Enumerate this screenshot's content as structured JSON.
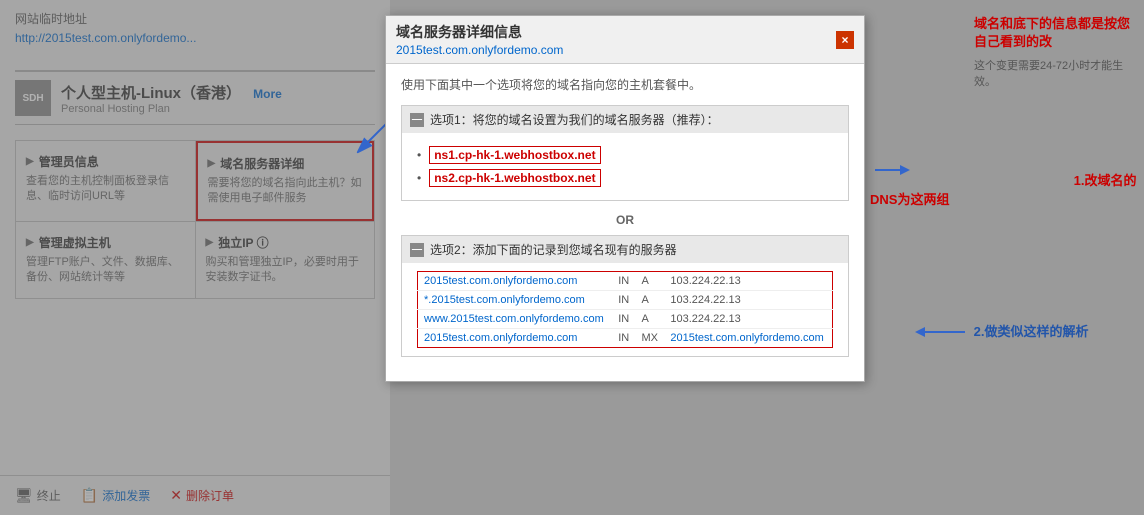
{
  "page": {
    "title": "网站临时地址",
    "site_url": "http://2015test.com.onlyfordemo...",
    "hosting_plan": {
      "logo": "SDH",
      "name": "个人型主机-Linux（香港）",
      "subtitle": "Personal Hosting Plan",
      "more_label": "More"
    },
    "menu_items": [
      {
        "title": "管理员信息",
        "desc": "查看您的主机控制面板登录信息、临时访问URL等",
        "highlighted": false
      },
      {
        "title": "域名服务器详细",
        "desc": "需要将您的域名指向此主机？如需使用电子邮件服务",
        "highlighted": true
      },
      {
        "title": "管理虚拟主机",
        "desc": "管理FTP账户、文件、数据库、备份、网站统计等等",
        "highlighted": false
      },
      {
        "title": "独立IP ⓘ",
        "desc": "购买和管理独立IP，必要时用于安装数字证书。",
        "highlighted": false
      }
    ],
    "bottom_actions": [
      {
        "icon": "🖥",
        "label": "终止",
        "type": "normal"
      },
      {
        "icon": "📋",
        "label": "添加发票",
        "type": "add"
      },
      {
        "icon": "✕",
        "label": "删除订单",
        "type": "delete"
      }
    ]
  },
  "modal": {
    "title": "域名服务器详细信息",
    "domain": "2015test.com.onlyfordemo.com",
    "intro": "使用下面其中一个选项将您的域名指向您的主机套餐中。",
    "option1": {
      "label": "选项1：将您的域名设置为我们的域名服务器（推荐）：",
      "ns1": "ns1.cp-hk-1.webhostbox.net",
      "ns2": "ns2.cp-hk-1.webhostbox.net"
    },
    "or_text": "OR",
    "option2": {
      "label": "选项2：添加下面的记录到您域名现有的服务器",
      "records": [
        {
          "domain": "2015test.com.onlyfordemo.com",
          "class": "IN",
          "type": "A",
          "value": "103.224.22.13"
        },
        {
          "domain": "*.2015test.com.onlyfordemo.com",
          "class": "IN",
          "type": "A",
          "value": "103.224.22.13"
        },
        {
          "domain": "www.2015test.com.onlyfordemo.com",
          "class": "IN",
          "type": "A",
          "value": "103.224.22.13"
        },
        {
          "domain": "2015test.com.onlyfordemo.com",
          "class": "IN",
          "type": "MX",
          "value": "2015test.com.onlyfordemo.com"
        }
      ]
    },
    "close_label": "×"
  },
  "annotations": {
    "top_right": "域名和底下的信息都是按您自己看到的改",
    "change_time": "这个变更需要24-72小时才能生效。",
    "arrow1": "1.改域名的DNS为这两组",
    "arrow2": "2.做类似这样的解析"
  }
}
